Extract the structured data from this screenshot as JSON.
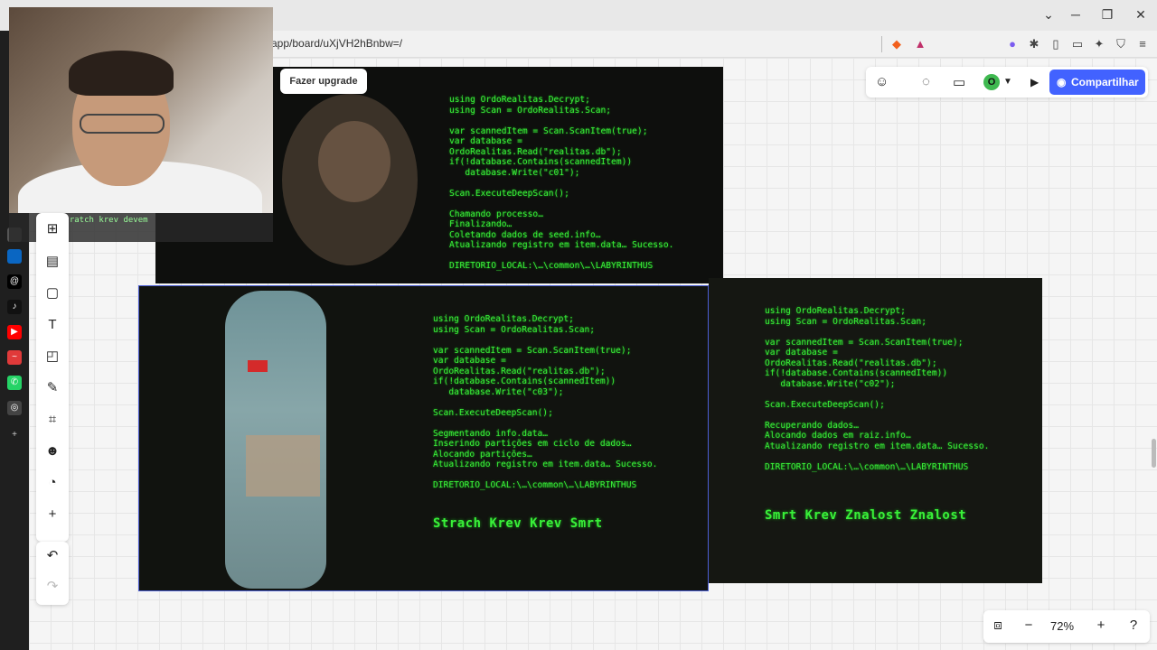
{
  "browser": {
    "url": "app/board/uXjVH2hBnbw=/",
    "window_controls": {
      "minimize": "─",
      "restore": "❐",
      "close": "✕",
      "dropdown": "⌄"
    }
  },
  "board": {
    "upgrade_label": "Fazer upgrade",
    "share_label": "Compartilhar",
    "avatar_initial": "O",
    "zoom_level": "72%",
    "zoom_out": "−",
    "zoom_in": "+",
    "help": "?",
    "accent_color": "#4262ff"
  },
  "toolbar": {
    "tools": [
      "templates",
      "sticky-note",
      "text",
      "shapes",
      "pen",
      "frame",
      "emoji",
      "comment",
      "add"
    ]
  },
  "images": {
    "top": {
      "code": "using OrdoRealitas.Decrypt;\nusing Scan = OrdoRealitas.Scan;\n\nvar scannedItem = Scan.ScanItem(true);\nvar database =\nOrdoRealitas.Read(\"realitas.db\");\nif(!database.Contains(scannedItem))\n   database.Write(\"c01\");\n\nScan.ExecuteDeepScan();\n\nChamando processo…\nFinalizando…\nColetando dados de seed.info…\nAtualizando registro em item.data… Sucesso.\n\nDIRETORIO_LOCAL:\\…\\common\\…\\LABYRINTHUS"
    },
    "middle": {
      "code": "using OrdoRealitas.Decrypt;\nusing Scan = OrdoRealitas.Scan;\n\nvar scannedItem = Scan.ScanItem(true);\nvar database =\nOrdoRealitas.Read(\"realitas.db\");\nif(!database.Contains(scannedItem))\n   database.Write(\"c03\");\n\nScan.ExecuteDeepScan();\n\nSegmentando info.data…\nInserindo partições em ciclo de dados…\nAlocando partições…\nAtualizando registro em item.data… Sucesso.\n\nDIRETORIO_LOCAL:\\…\\common\\…\\LABYRINTHUS",
      "headline": "Strach Krev Krev Smrt"
    },
    "right": {
      "code": "using OrdoRealitas.Decrypt;\nusing Scan = OrdoRealitas.Scan;\n\nvar scannedItem = Scan.ScanItem(true);\nvar database =\nOrdoRealitas.Read(\"realitas.db\");\nif(!database.Contains(scannedItem))\n   database.Write(\"c02\");\n\nScan.ExecuteDeepScan();\n\nRecuperando dados…\nAlocando dados em raiz.info…\nAtualizando registro em item.data… Sucesso.\n\nDIRETORIO_LOCAL:\\…\\common\\…\\LABYRINTHUS",
      "headline": "Smrt Krev Znalost Znalost"
    }
  },
  "stream_chat": {
    "message": "scratch krev devem"
  }
}
